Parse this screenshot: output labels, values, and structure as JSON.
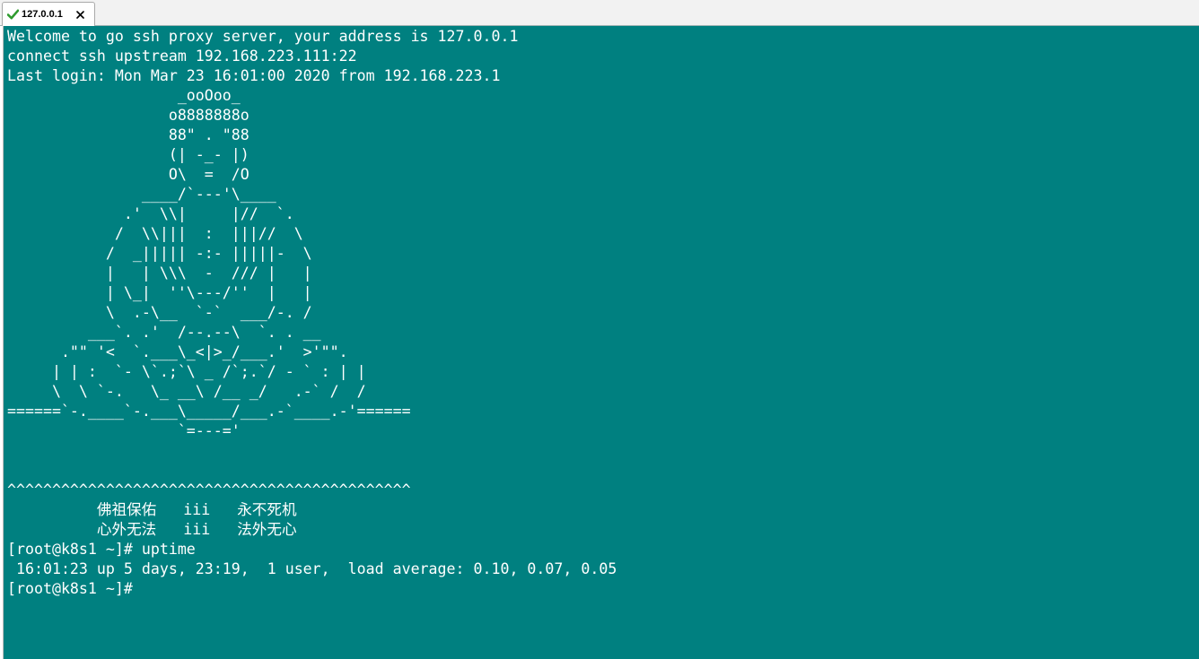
{
  "tab": {
    "title": "127.0.0.1",
    "status_icon": "check-icon",
    "close_icon": "close-icon",
    "status_color": "#2e9b2e"
  },
  "terminal": {
    "background": "#008080",
    "foreground": "#ffffff",
    "text": "Welcome to go ssh proxy server, your address is 127.0.0.1\nconnect ssh upstream 192.168.223.111:22\nLast login: Mon Mar 23 16:01:00 2020 from 192.168.223.1\n                   _ooOoo_\n                  o8888888o\n                  88\" . \"88\n                  (| -_- |)\n                  O\\  =  /O\n               ____/`---'\\____\n             .'  \\\\|     |//  `.\n            /  \\\\|||  :  |||//  \\\n           /  _||||| -:- |||||-  \\\n           |   | \\\\\\  -  /// |   |\n           | \\_|  ''\\---/''  |   |\n           \\  .-\\__  `-`  ___/-. /\n         ___`. .'  /--.--\\  `. . __\n      .\"\" '<  `.___\\_<|>_/___.'  >'\"\".\n     | | :  `- \\`.;`\\ _ /`;.`/ - ` : | |\n     \\  \\ `-.   \\_ __\\ /__ _/   .-` /  /\n======`-.____`-.___\\_____/___.-`____.-'======\n                   `=---='\n\n\n^^^^^^^^^^^^^^^^^^^^^^^^^^^^^^^^^^^^^^^^^^^^^\n          佛祖保佑   iii   永不死机\n          心外无法   iii   法外无心\n[root@k8s1 ~]# uptime\n 16:01:23 up 5 days, 23:19,  1 user,  load average: 0.10, 0.07, 0.05\n[root@k8s1 ~]#"
  }
}
